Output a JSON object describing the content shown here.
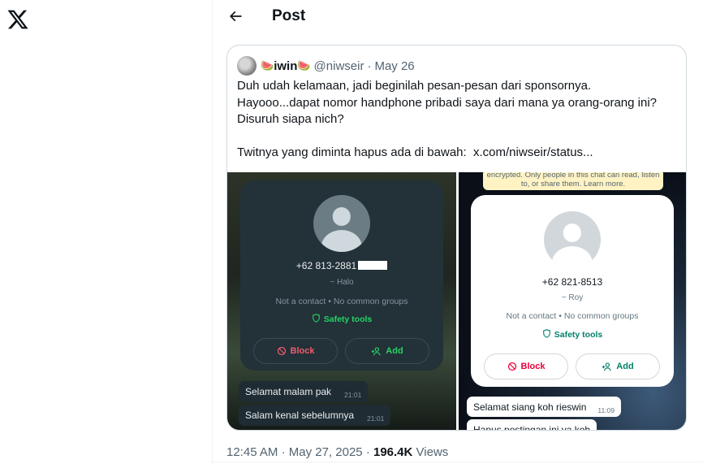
{
  "nav": {
    "logo": "x-logo"
  },
  "header": {
    "title": "Post",
    "back_icon": "arrow-left-icon"
  },
  "quote": {
    "display_name": "iwin",
    "name_emoji": "🍉",
    "handle": "@niwseir",
    "separator": "·",
    "date": "May 26",
    "text": "Duh udah kelamaan, jadi beginilah pesan-pesan dari sponsornya.\nHayooo...dapat nomor handphone pribadi saya dari mana ya orang-orang ini? Disuruh siapa nich?\n\nTwitnya yang diminta hapus ada di bawah:  x.com/niwseir/status...",
    "images": [
      {
        "theme": "dark",
        "phone": "+62 813-2881",
        "about": "~ Halo",
        "info": "Not a contact • No common groups",
        "safety": "Safety tools",
        "block": "Block",
        "add": "Add",
        "messages": [
          {
            "text": "Selamat malam pak",
            "time": "21:01"
          },
          {
            "text": "Salam kenal sebelumnya",
            "time": "21:01"
          }
        ]
      },
      {
        "theme": "light",
        "banner": "encrypted. Only people in this chat can read, listen to, or share them. Learn more.",
        "phone": "+62 821-8513",
        "about": "~ Roy",
        "info": "Not a contact • No common groups",
        "safety": "Safety tools",
        "block": "Block",
        "add": "Add",
        "messages": [
          {
            "text": "Selamat siang koh rieswin",
            "time": "11:09"
          },
          {
            "text": "Hapus postingan ini ya koh",
            "time": ""
          }
        ]
      }
    ]
  },
  "meta": {
    "time": "12:45 AM",
    "dot1": "·",
    "date": "May 27, 2025",
    "dot2": "·",
    "views_count": "196.4K",
    "views_label": "Views"
  },
  "colors": {
    "text": "#0f1419",
    "muted": "#536471",
    "border": "#cfd9de",
    "wa_green_dark": "#25d366",
    "wa_green_light": "#008069",
    "wa_red": "#ea0038"
  }
}
